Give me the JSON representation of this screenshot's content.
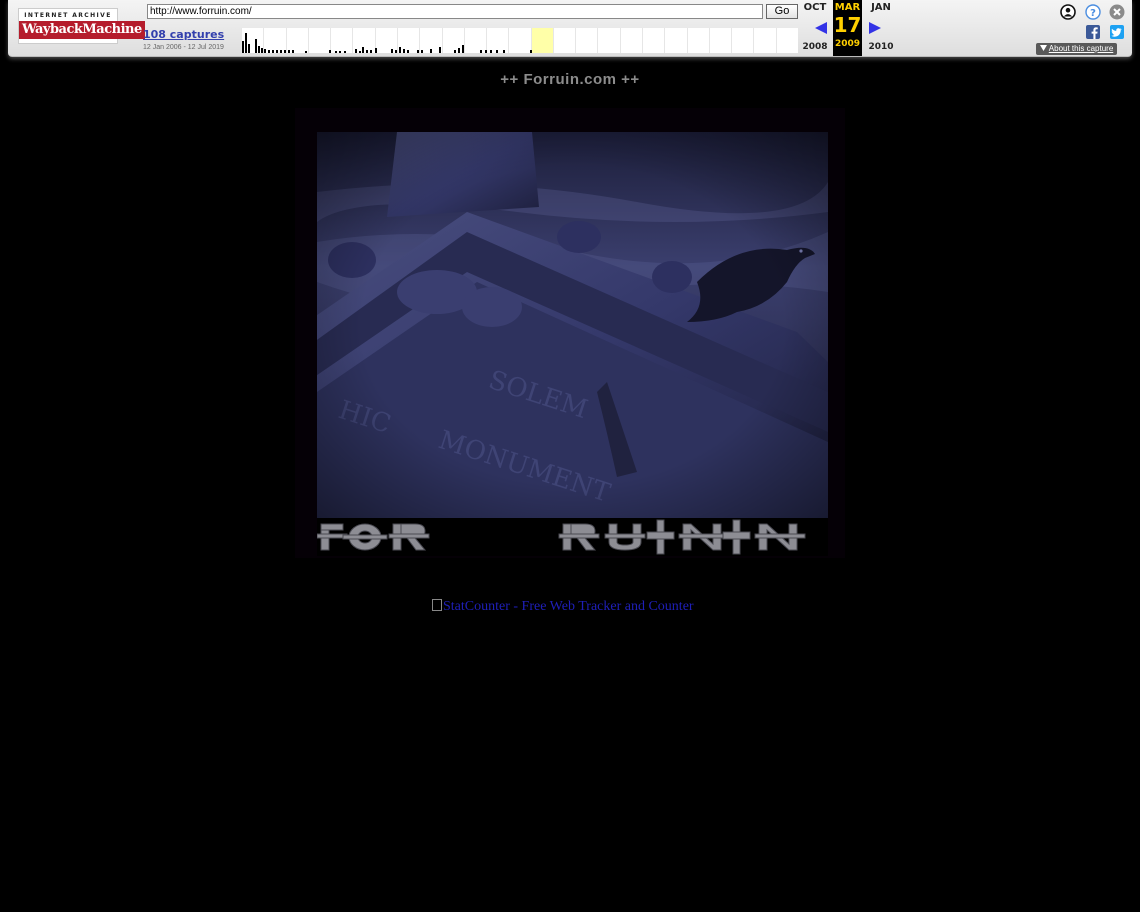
{
  "toolbar": {
    "logo_top": "INTERNET ARCHIVE",
    "logo_main": "WaybackMachine",
    "url_value": "http://www.forruin.com/",
    "go_label": "Go",
    "captures_label": "108 captures",
    "date_range": "12 Jan 2006 - 12 Jul 2019",
    "prev_month": "OCT",
    "current_month": "MAR",
    "next_month": "JAN",
    "current_day": "17",
    "prev_year": "2008",
    "current_year": "2009",
    "next_year": "2010",
    "about_label": "About this capture",
    "accent_color": "#ffd000",
    "icons": [
      "user-icon",
      "help-icon",
      "close-icon",
      "facebook-icon",
      "twitter-icon"
    ]
  },
  "page": {
    "title": "++ Forruin.com ++",
    "banner_alt": "FOR RUIN",
    "statcounter_text": "StatCounter - Free Web Tracker and Counter"
  }
}
